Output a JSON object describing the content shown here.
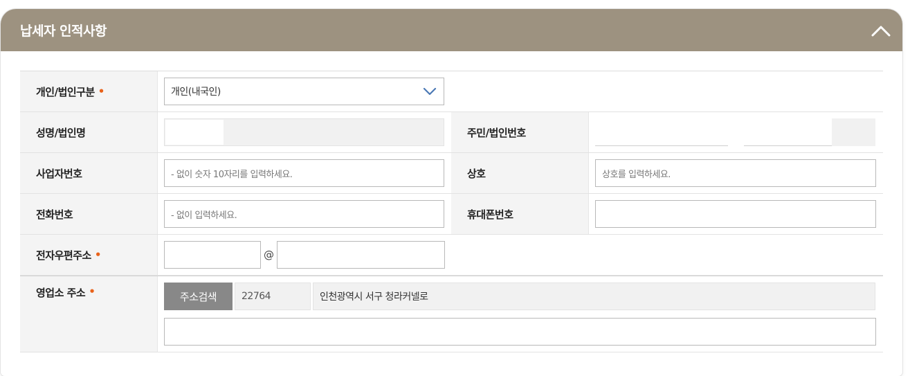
{
  "header": {
    "title": "납세자 인적사항",
    "collapse_icon": "chevron-up-icon"
  },
  "colors": {
    "header_bg": "#9d9280",
    "required_dot": "#e8621a",
    "button_gray": "#888888",
    "select_chevron": "#4a78b5"
  },
  "form": {
    "type": {
      "label": "개인/법인구분",
      "required_mark": "•",
      "selected": "개인(내국인)"
    },
    "name": {
      "label": "성명/법인명"
    },
    "id_number": {
      "label": "주민/법인번호"
    },
    "business_number": {
      "label": "사업자번호",
      "placeholder": "- 없이 숫자 10자리를 입력하세요."
    },
    "company": {
      "label": "상호",
      "placeholder": "상호를 입력하세요."
    },
    "phone": {
      "label": "전화번호",
      "placeholder": "- 없이 입력하세요."
    },
    "mobile": {
      "label": "휴대폰번호"
    },
    "email": {
      "label": "전자우편주소",
      "required_mark": "•",
      "at": "@"
    },
    "address": {
      "label": "영업소 주소",
      "required_mark": "•",
      "search_button": "주소검색",
      "postal_code": "22764",
      "road_address": "인천광역시 서구 청라커넬로"
    }
  }
}
